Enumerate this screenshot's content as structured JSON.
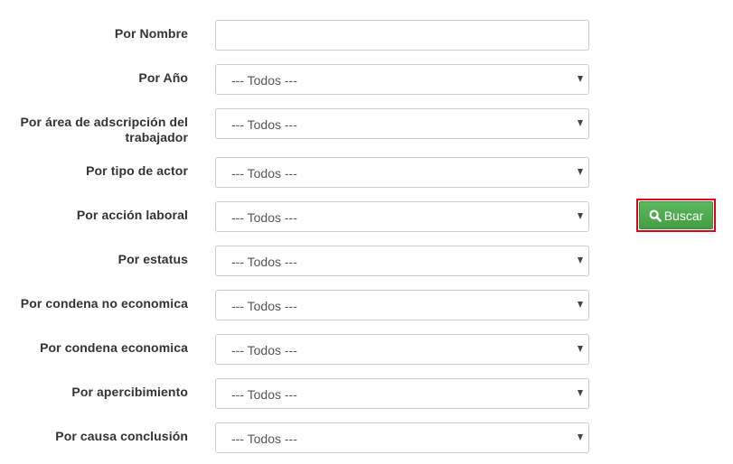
{
  "filters": {
    "nombre": {
      "label": "Por Nombre",
      "value": ""
    },
    "anio": {
      "label": "Por Año",
      "selected": "--- Todos ---"
    },
    "area": {
      "label_line1": "Por área de adscripción del",
      "label_line2": "trabajador",
      "selected": "--- Todos ---"
    },
    "tipo_actor": {
      "label": "Por tipo de actor",
      "selected": "--- Todos ---"
    },
    "accion_laboral": {
      "label": "Por acción laboral",
      "selected": "--- Todos ---"
    },
    "estatus": {
      "label": "Por estatus",
      "selected": "--- Todos ---"
    },
    "condena_no_economica": {
      "label": "Por condena no economica",
      "selected": "--- Todos ---"
    },
    "condena_economica": {
      "label": "Por condena economica",
      "selected": "--- Todos ---"
    },
    "apercibimiento": {
      "label": "Por apercibimiento",
      "selected": "--- Todos ---"
    },
    "causa_conclusion": {
      "label": "Por causa conclusión",
      "selected": "--- Todos ---"
    }
  },
  "search_button": {
    "label": "Buscar",
    "icon": "search-icon",
    "color": "#5cb85c",
    "highlight_color": "#e0001b"
  }
}
